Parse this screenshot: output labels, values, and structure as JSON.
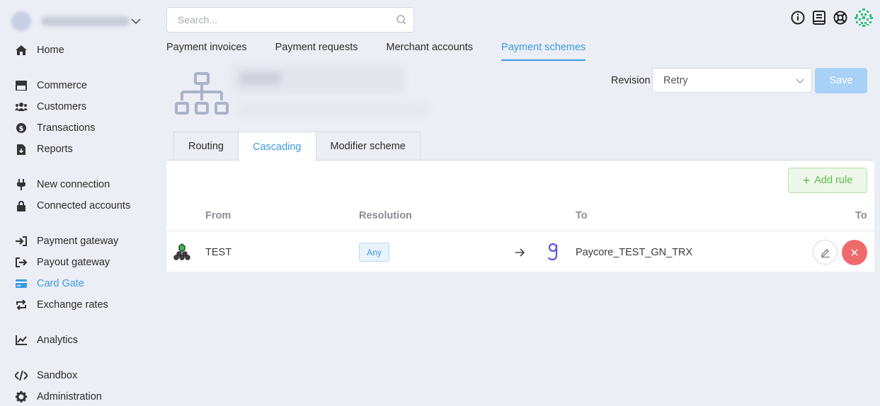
{
  "sidebar": {
    "items": [
      {
        "label": "Home",
        "icon": "home-icon"
      },
      {
        "label": "Commerce",
        "icon": "store-icon"
      },
      {
        "label": "Customers",
        "icon": "users-icon"
      },
      {
        "label": "Transactions",
        "icon": "dollar-icon"
      },
      {
        "label": "Reports",
        "icon": "report-icon"
      },
      {
        "label": "New connection",
        "icon": "plug-icon"
      },
      {
        "label": "Connected accounts",
        "icon": "lock-icon"
      },
      {
        "label": "Payment gateway",
        "icon": "sign-in-icon"
      },
      {
        "label": "Payout gateway",
        "icon": "sign-out-icon"
      },
      {
        "label": "Card Gate",
        "icon": "card-icon"
      },
      {
        "label": "Exchange rates",
        "icon": "exchange-icon"
      },
      {
        "label": "Analytics",
        "icon": "chart-icon"
      },
      {
        "label": "Sandbox",
        "icon": "code-icon"
      },
      {
        "label": "Administration",
        "icon": "gear-icon"
      }
    ]
  },
  "search": {
    "placeholder": "Search..."
  },
  "main_tabs": [
    {
      "label": "Payment invoices"
    },
    {
      "label": "Payment requests"
    },
    {
      "label": "Merchant accounts"
    },
    {
      "label": "Payment schemes"
    }
  ],
  "header": {
    "revision_label": "Revision",
    "revision_value": "Retry",
    "save_label": "Save"
  },
  "sub_tabs": [
    {
      "label": "Routing"
    },
    {
      "label": "Cascading"
    },
    {
      "label": "Modifier scheme"
    }
  ],
  "table": {
    "add_rule_label": "Add rule",
    "columns": {
      "from": "From",
      "resolution": "Resolution",
      "to": "To",
      "to2": "To"
    },
    "rows": [
      {
        "from": "TEST",
        "resolution": "Any",
        "to": "Paycore_TEST_GN_TRX"
      }
    ]
  },
  "colors": {
    "accent": "#3a9be0",
    "danger": "#ef6b6b",
    "success": "#5cb84a"
  }
}
